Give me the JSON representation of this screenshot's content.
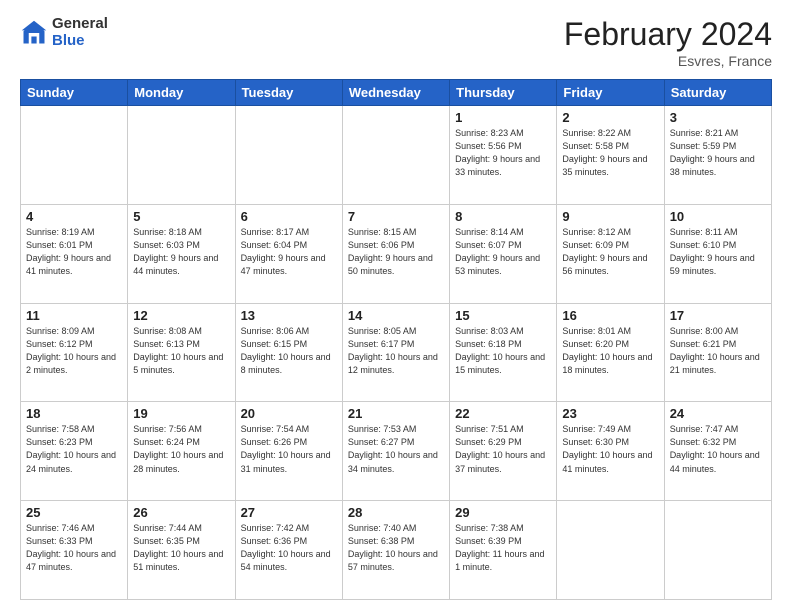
{
  "logo": {
    "general": "General",
    "blue": "Blue"
  },
  "header": {
    "month": "February 2024",
    "location": "Esvres, France"
  },
  "weekdays": [
    "Sunday",
    "Monday",
    "Tuesday",
    "Wednesday",
    "Thursday",
    "Friday",
    "Saturday"
  ],
  "weeks": [
    [
      {
        "day": "",
        "sunrise": "",
        "sunset": "",
        "daylight": ""
      },
      {
        "day": "",
        "sunrise": "",
        "sunset": "",
        "daylight": ""
      },
      {
        "day": "",
        "sunrise": "",
        "sunset": "",
        "daylight": ""
      },
      {
        "day": "",
        "sunrise": "",
        "sunset": "",
        "daylight": ""
      },
      {
        "day": "1",
        "sunrise": "8:23 AM",
        "sunset": "5:56 PM",
        "daylight": "9 hours and 33 minutes."
      },
      {
        "day": "2",
        "sunrise": "8:22 AM",
        "sunset": "5:58 PM",
        "daylight": "9 hours and 35 minutes."
      },
      {
        "day": "3",
        "sunrise": "8:21 AM",
        "sunset": "5:59 PM",
        "daylight": "9 hours and 38 minutes."
      }
    ],
    [
      {
        "day": "4",
        "sunrise": "8:19 AM",
        "sunset": "6:01 PM",
        "daylight": "9 hours and 41 minutes."
      },
      {
        "day": "5",
        "sunrise": "8:18 AM",
        "sunset": "6:03 PM",
        "daylight": "9 hours and 44 minutes."
      },
      {
        "day": "6",
        "sunrise": "8:17 AM",
        "sunset": "6:04 PM",
        "daylight": "9 hours and 47 minutes."
      },
      {
        "day": "7",
        "sunrise": "8:15 AM",
        "sunset": "6:06 PM",
        "daylight": "9 hours and 50 minutes."
      },
      {
        "day": "8",
        "sunrise": "8:14 AM",
        "sunset": "6:07 PM",
        "daylight": "9 hours and 53 minutes."
      },
      {
        "day": "9",
        "sunrise": "8:12 AM",
        "sunset": "6:09 PM",
        "daylight": "9 hours and 56 minutes."
      },
      {
        "day": "10",
        "sunrise": "8:11 AM",
        "sunset": "6:10 PM",
        "daylight": "9 hours and 59 minutes."
      }
    ],
    [
      {
        "day": "11",
        "sunrise": "8:09 AM",
        "sunset": "6:12 PM",
        "daylight": "10 hours and 2 minutes."
      },
      {
        "day": "12",
        "sunrise": "8:08 AM",
        "sunset": "6:13 PM",
        "daylight": "10 hours and 5 minutes."
      },
      {
        "day": "13",
        "sunrise": "8:06 AM",
        "sunset": "6:15 PM",
        "daylight": "10 hours and 8 minutes."
      },
      {
        "day": "14",
        "sunrise": "8:05 AM",
        "sunset": "6:17 PM",
        "daylight": "10 hours and 12 minutes."
      },
      {
        "day": "15",
        "sunrise": "8:03 AM",
        "sunset": "6:18 PM",
        "daylight": "10 hours and 15 minutes."
      },
      {
        "day": "16",
        "sunrise": "8:01 AM",
        "sunset": "6:20 PM",
        "daylight": "10 hours and 18 minutes."
      },
      {
        "day": "17",
        "sunrise": "8:00 AM",
        "sunset": "6:21 PM",
        "daylight": "10 hours and 21 minutes."
      }
    ],
    [
      {
        "day": "18",
        "sunrise": "7:58 AM",
        "sunset": "6:23 PM",
        "daylight": "10 hours and 24 minutes."
      },
      {
        "day": "19",
        "sunrise": "7:56 AM",
        "sunset": "6:24 PM",
        "daylight": "10 hours and 28 minutes."
      },
      {
        "day": "20",
        "sunrise": "7:54 AM",
        "sunset": "6:26 PM",
        "daylight": "10 hours and 31 minutes."
      },
      {
        "day": "21",
        "sunrise": "7:53 AM",
        "sunset": "6:27 PM",
        "daylight": "10 hours and 34 minutes."
      },
      {
        "day": "22",
        "sunrise": "7:51 AM",
        "sunset": "6:29 PM",
        "daylight": "10 hours and 37 minutes."
      },
      {
        "day": "23",
        "sunrise": "7:49 AM",
        "sunset": "6:30 PM",
        "daylight": "10 hours and 41 minutes."
      },
      {
        "day": "24",
        "sunrise": "7:47 AM",
        "sunset": "6:32 PM",
        "daylight": "10 hours and 44 minutes."
      }
    ],
    [
      {
        "day": "25",
        "sunrise": "7:46 AM",
        "sunset": "6:33 PM",
        "daylight": "10 hours and 47 minutes."
      },
      {
        "day": "26",
        "sunrise": "7:44 AM",
        "sunset": "6:35 PM",
        "daylight": "10 hours and 51 minutes."
      },
      {
        "day": "27",
        "sunrise": "7:42 AM",
        "sunset": "6:36 PM",
        "daylight": "10 hours and 54 minutes."
      },
      {
        "day": "28",
        "sunrise": "7:40 AM",
        "sunset": "6:38 PM",
        "daylight": "10 hours and 57 minutes."
      },
      {
        "day": "29",
        "sunrise": "7:38 AM",
        "sunset": "6:39 PM",
        "daylight": "11 hours and 1 minute."
      },
      {
        "day": "",
        "sunrise": "",
        "sunset": "",
        "daylight": ""
      },
      {
        "day": "",
        "sunrise": "",
        "sunset": "",
        "daylight": ""
      }
    ]
  ],
  "labels": {
    "sunrise_prefix": "Sunrise: ",
    "sunset_prefix": "Sunset: ",
    "daylight_prefix": "Daylight: "
  }
}
